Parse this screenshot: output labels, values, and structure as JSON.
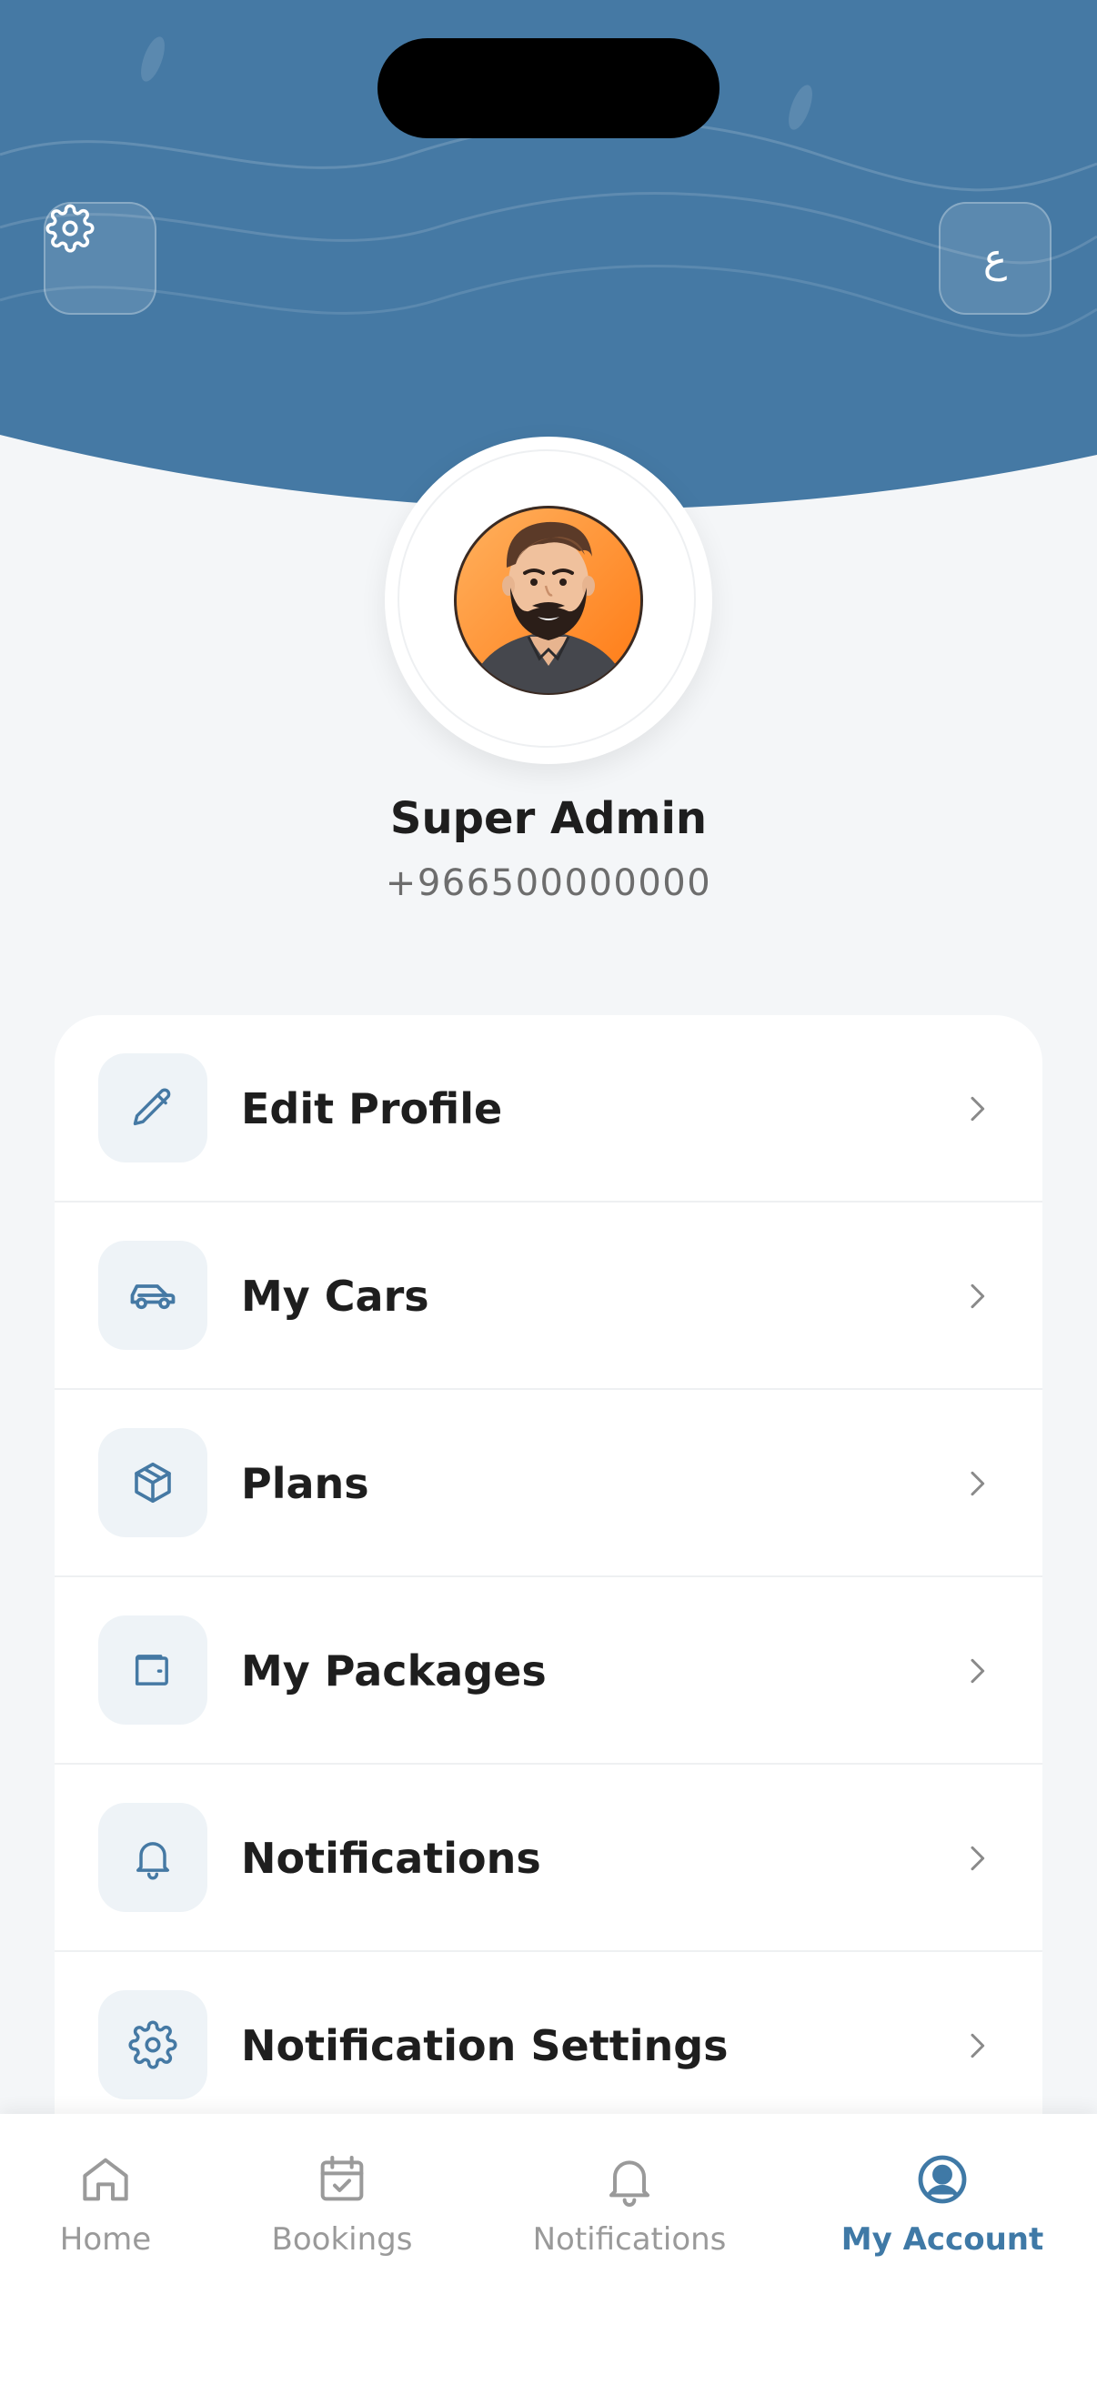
{
  "header": {
    "settings_icon": "gear-icon",
    "language_toggle": "ع",
    "colors": {
      "primary": "#4579a4",
      "background": "#f4f6f8"
    }
  },
  "profile": {
    "name": "Super Admin",
    "phone": "+966500000000"
  },
  "menu": {
    "items": [
      {
        "label": "Edit Profile",
        "icon": "pencil-icon"
      },
      {
        "label": "My Cars",
        "icon": "car-icon"
      },
      {
        "label": "Plans",
        "icon": "box-icon"
      },
      {
        "label": "My Packages",
        "icon": "wallet-icon"
      },
      {
        "label": "Notifications",
        "icon": "bell-icon"
      },
      {
        "label": "Notification Settings",
        "icon": "gear-icon"
      }
    ]
  },
  "tabbar": {
    "tabs": [
      {
        "label": "Home",
        "icon": "home-icon",
        "active": false
      },
      {
        "label": "Bookings",
        "icon": "calendar-check-icon",
        "active": false
      },
      {
        "label": "Notifications",
        "icon": "bell-icon",
        "active": false
      },
      {
        "label": "My Account",
        "icon": "user-circle-icon",
        "active": true
      }
    ],
    "active_color": "#3f79a6",
    "inactive_color": "#9a9a9a"
  }
}
